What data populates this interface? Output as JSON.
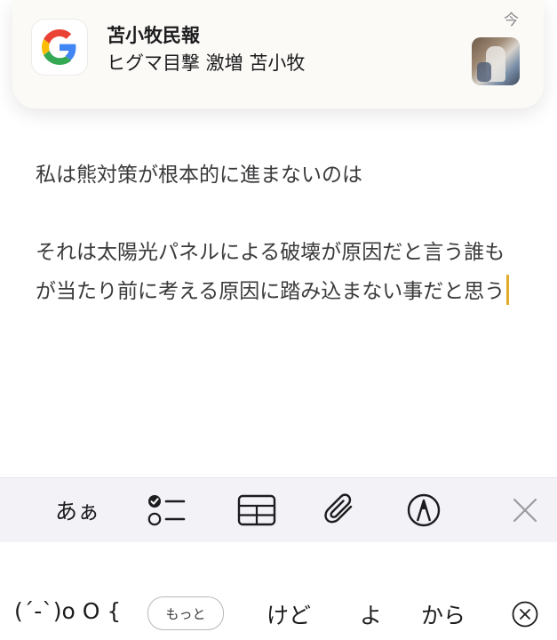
{
  "notification": {
    "app_icon": "google-g-icon",
    "title": "苫小牧民報",
    "body": "ヒグマ目撃 激増 苫小牧",
    "time": "今"
  },
  "note": {
    "line1": "私は熊対策が根本的に進まないのは",
    "paragraph2": "それは太陽光パネルによる破壊が原因だと言う誰もが当たり前に考える原因に踏み込まない事だと思う"
  },
  "toolbar": {
    "format_label": "あぁ",
    "icons": [
      "checklist-icon",
      "table-icon",
      "paperclip-icon",
      "markup-pen-icon",
      "close-icon"
    ]
  },
  "keyboard": {
    "suggestion_kaomoji": "(´-`)o O {",
    "more_label": "もっと",
    "suggestion_1": "けど",
    "suggestion_2": "よ",
    "suggestion_3": "から",
    "dismiss_icon": "circle-x-icon"
  },
  "colors": {
    "cursor": "#e1ad2b",
    "toolbar_bg": "#f2f2f7",
    "notification_bg": "#fbfaf7"
  }
}
